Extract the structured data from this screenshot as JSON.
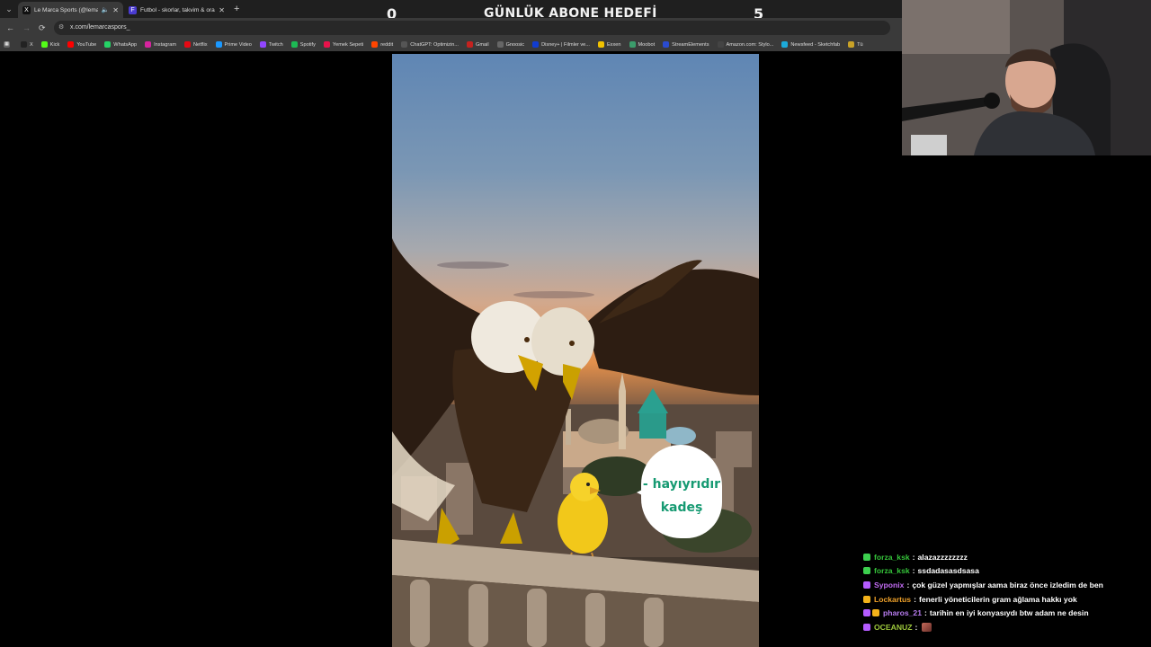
{
  "browser": {
    "tabs": [
      {
        "label": "Le Marca Sports (@lemarca",
        "favicon": "X",
        "active": true,
        "audio": true
      },
      {
        "label": "Futbol - skorlar, takvim & oran",
        "favicon": "F",
        "active": false,
        "audio": false
      }
    ],
    "url": "x.com/lemarcaspors_",
    "bookmarks": [
      {
        "label": "X",
        "icon": "x-logo",
        "color": "#222222"
      },
      {
        "label": "Kick",
        "icon": "kick-logo",
        "color": "#53fc18"
      },
      {
        "label": "YouTube",
        "icon": "youtube-logo",
        "color": "#ff0000"
      },
      {
        "label": "WhatsApp",
        "icon": "whatsapp-logo",
        "color": "#25d366"
      },
      {
        "label": "Instagram",
        "icon": "instagram-logo",
        "color": "#d6249f"
      },
      {
        "label": "Netflix",
        "icon": "netflix-logo",
        "color": "#e50914"
      },
      {
        "label": "Prime Video",
        "icon": "prime-logo",
        "color": "#1a98ff"
      },
      {
        "label": "Twitch",
        "icon": "twitch-logo",
        "color": "#9146ff"
      },
      {
        "label": "Spotify",
        "icon": "spotify-logo",
        "color": "#1db954"
      },
      {
        "label": "Yemek Sepeti",
        "icon": "yemeksepeti-logo",
        "color": "#e8124b"
      },
      {
        "label": "reddit",
        "icon": "reddit-logo",
        "color": "#ff4500"
      },
      {
        "label": "ChatGPT: Optimizin...",
        "icon": "chatgpt-logo",
        "color": "#555555"
      },
      {
        "label": "Gmail",
        "icon": "gmail-logo",
        "color": "#c5221f"
      },
      {
        "label": "Gnoosic",
        "icon": "gnoosic-logo",
        "color": "#666666"
      },
      {
        "label": "Disney+ | Filmler ve...",
        "icon": "disney-logo",
        "color": "#113ccf"
      },
      {
        "label": "Exxen",
        "icon": "exxen-logo",
        "color": "#f2c200"
      },
      {
        "label": "Moobot",
        "icon": "moobot-logo",
        "color": "#3b9c6b"
      },
      {
        "label": "StreamElements",
        "icon": "streamelements-logo",
        "color": "#2a4bd0"
      },
      {
        "label": "Amazon.com: Stylo...",
        "icon": "amazon-logo",
        "color": "#444444"
      },
      {
        "label": "Newsfeed - Sketchfab",
        "icon": "sketchfab-logo",
        "color": "#1caad9"
      },
      {
        "label": "Tü",
        "icon": "site-logo",
        "color": "#c9a227"
      }
    ]
  },
  "overlay": {
    "left_count": "0",
    "title": "GÜNLÜK ABONE HEDEFİ",
    "right_count": "5"
  },
  "post": {
    "bubble_line1": "- hayıyrıdır",
    "bubble_line2": "kadeş"
  },
  "chat": [
    {
      "user": "forza_ksk",
      "color": "#35c43a",
      "badges": [
        "#3ccf4e"
      ],
      "text": "alazazzzzzzzz"
    },
    {
      "user": "forza_ksk",
      "color": "#35c43a",
      "badges": [
        "#3ccf4e"
      ],
      "text": "ssdadasasdsasa"
    },
    {
      "user": "Syponix",
      "color": "#c16bf2",
      "badges": [
        "#b55cff"
      ],
      "text": "çok güzel yapmışlar aama biraz önce izledim de ben"
    },
    {
      "user": "Lockartus",
      "color": "#f0a22a",
      "badges": [
        "#f3b21a"
      ],
      "text": "fenerli yöneticilerin gram ağlama hakkı yok"
    },
    {
      "user": "pharos_21",
      "color": "#b77cf0",
      "badges": [
        "#b55cff",
        "#f3b21a"
      ],
      "text": "tarihin en iyi konyasıydı btw adam ne desin"
    },
    {
      "user": "OCEANUZ",
      "color": "#9ec93c",
      "badges": [
        "#b55cff"
      ],
      "text": "",
      "emote": true
    }
  ]
}
